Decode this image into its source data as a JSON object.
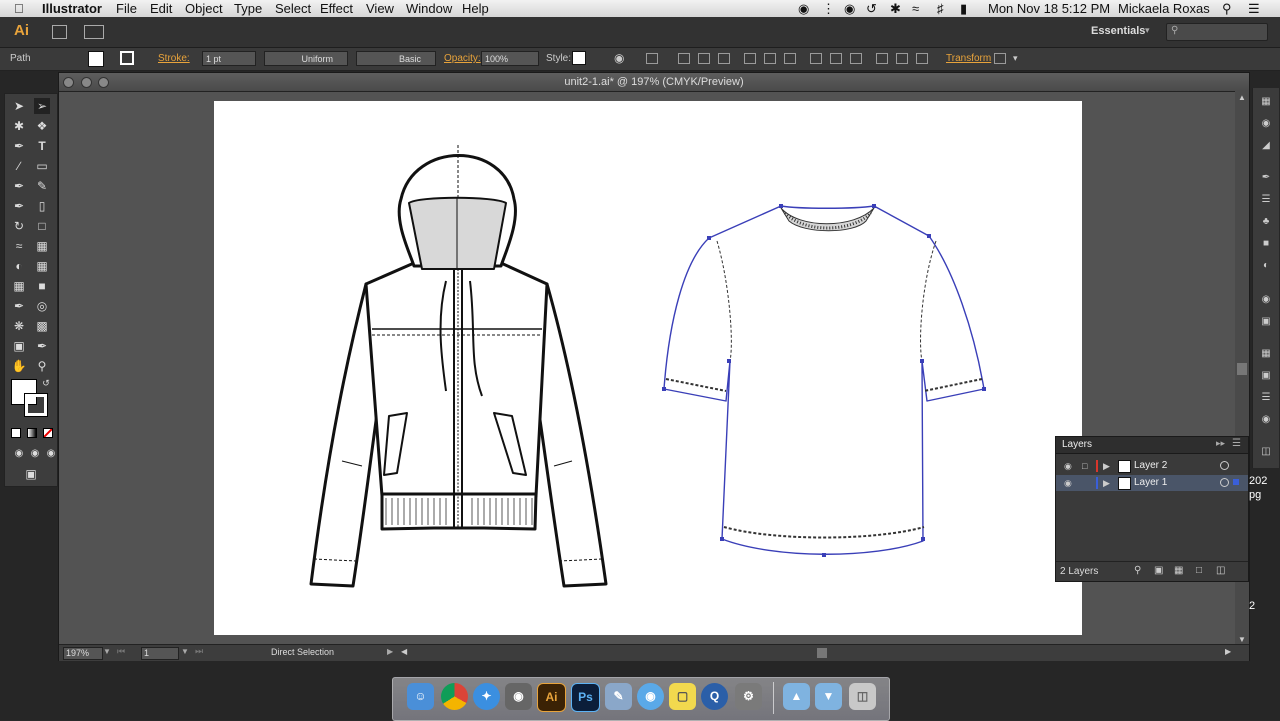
{
  "menubar": {
    "app": "Illustrator",
    "items": [
      "File",
      "Edit",
      "Object",
      "Type",
      "Select",
      "Effect",
      "View",
      "Window",
      "Help"
    ],
    "datetime": "Mon Nov 18  5:12 PM",
    "user": "Mickaela Roxas"
  },
  "appbar": {
    "logo": "Ai",
    "workspace": "Essentials"
  },
  "control": {
    "selection": "Path",
    "stroke_label": "Stroke:",
    "stroke_weight": "1 pt",
    "profile": "Uniform",
    "brush": "Basic",
    "opacity_label": "Opacity:",
    "opacity": "100%",
    "style_label": "Style:",
    "transform_label": "Transform"
  },
  "document": {
    "title": "unit2-1.ai* @ 197% (CMYK/Preview)",
    "zoom": "197%",
    "page": "1",
    "current_tool": "Direct Selection"
  },
  "layers": {
    "title": "Layers",
    "rows": [
      {
        "name": "Layer 2",
        "color": "#d9362b"
      },
      {
        "name": "Layer 1",
        "color": "#3a5fd9"
      }
    ],
    "count": "2 Layers"
  },
  "offscreen": {
    "a": "202",
    "b": "pg",
    "c": "2"
  },
  "dock": {
    "apps": [
      "finder",
      "chrome",
      "safari",
      "facetime",
      "illustrator",
      "photoshop",
      "preview",
      "messages",
      "stickies",
      "quicktime",
      "preferences",
      "applications",
      "downloads",
      "trash"
    ]
  },
  "colors": {
    "accent": "#e8a33b",
    "selection_blue": "#3a3fb8"
  }
}
